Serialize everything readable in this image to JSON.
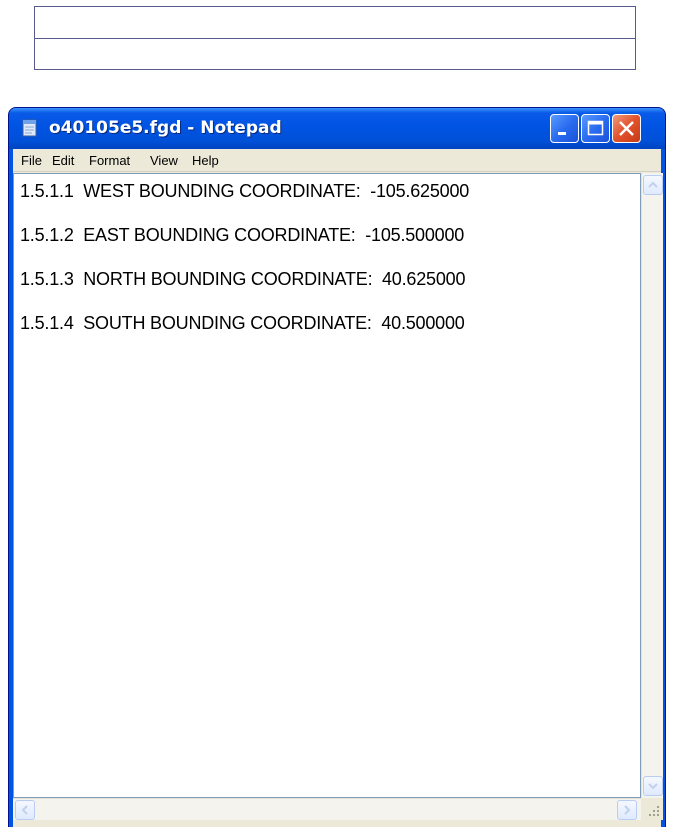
{
  "window": {
    "title": "o40105e5.fgd - Notepad"
  },
  "menu": [
    "File",
    "Edit",
    "Format",
    "View",
    "Help"
  ],
  "document": {
    "lines": [
      "1.5.1.1  WEST BOUNDING COORDINATE:  -105.625000",
      "1.5.1.2  EAST BOUNDING COORDINATE:  -105.500000",
      "1.5.1.3  NORTH BOUNDING COORDINATE:  40.625000",
      "1.5.1.4  SOUTH BOUNDING COORDINATE:  40.500000"
    ]
  },
  "icons": {
    "app": "notepad-icon",
    "minimize": "minimize-icon",
    "maximize": "maximize-icon",
    "close": "close-icon",
    "scroll_up": "arrow-up-icon",
    "scroll_down": "arrow-down-icon",
    "scroll_left": "arrow-left-icon",
    "scroll_right": "arrow-right-icon",
    "size_grip": "resize-grip-icon"
  },
  "colors": {
    "titlebar": "#0054e3",
    "close_button": "#e2512a",
    "chrome": "#ece9d8"
  }
}
